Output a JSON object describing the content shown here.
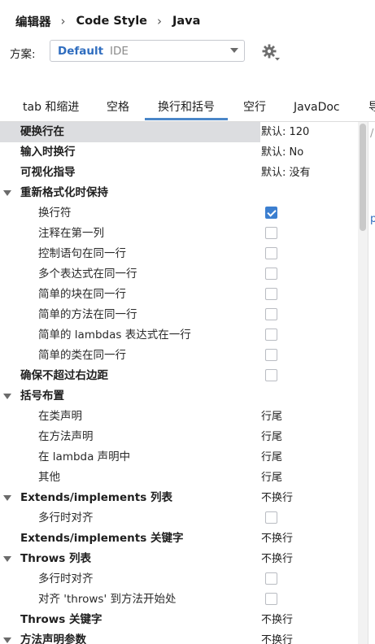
{
  "breadcrumb": [
    "编辑器",
    "Code Style",
    "Java"
  ],
  "scheme": {
    "label": "方案:",
    "name": "Default",
    "scope": "IDE"
  },
  "tabs": [
    {
      "label": "tab 和缩进",
      "active": false
    },
    {
      "label": "空格",
      "active": false
    },
    {
      "label": "换行和括号",
      "active": true
    },
    {
      "label": "空行",
      "active": false
    },
    {
      "label": "JavaDoc",
      "active": false
    },
    {
      "label": "导",
      "active": false
    }
  ],
  "preview_fragments": [
    "/",
    "p"
  ],
  "rows": [
    {
      "label": "硬换行在",
      "level": 0,
      "group": false,
      "selected": true,
      "value": "默认: 120"
    },
    {
      "label": "输入时换行",
      "level": 0,
      "group": false,
      "value": "默认: No"
    },
    {
      "label": "可视化指导",
      "level": 0,
      "group": false,
      "value": "默认: 没有"
    },
    {
      "label": "重新格式化时保持",
      "level": 0,
      "group": true
    },
    {
      "label": "换行符",
      "level": 1,
      "checkbox": true,
      "checked": true
    },
    {
      "label": "注释在第一列",
      "level": 1,
      "checkbox": true,
      "checked": false
    },
    {
      "label": "控制语句在同一行",
      "level": 1,
      "checkbox": true,
      "checked": false
    },
    {
      "label": "多个表达式在同一行",
      "level": 1,
      "checkbox": true,
      "checked": false
    },
    {
      "label": "简单的块在同一行",
      "level": 1,
      "checkbox": true,
      "checked": false
    },
    {
      "label": "简单的方法在同一行",
      "level": 1,
      "checkbox": true,
      "checked": false
    },
    {
      "label": "简单的 lambdas 表达式在一行",
      "level": 1,
      "checkbox": true,
      "checked": false
    },
    {
      "label": "简单的类在同一行",
      "level": 1,
      "checkbox": true,
      "checked": false
    },
    {
      "label": "确保不超过右边距",
      "level": 0,
      "group": false,
      "checkbox": true,
      "checked": false
    },
    {
      "label": "括号布置",
      "level": 0,
      "group": true
    },
    {
      "label": "在类声明",
      "level": 1,
      "value": "行尾"
    },
    {
      "label": "在方法声明",
      "level": 1,
      "value": "行尾"
    },
    {
      "label": "在 lambda 声明中",
      "level": 1,
      "value": "行尾"
    },
    {
      "label": "其他",
      "level": 1,
      "value": "行尾"
    },
    {
      "label": "Extends/implements 列表",
      "level": 0,
      "group": true,
      "value": "不换行"
    },
    {
      "label": "多行时对齐",
      "level": 1,
      "checkbox": true,
      "checked": false
    },
    {
      "label": "Extends/implements 关键字",
      "level": 0,
      "group": false,
      "value": "不换行"
    },
    {
      "label": "Throws 列表",
      "level": 0,
      "group": true,
      "value": "不换行"
    },
    {
      "label": "多行时对齐",
      "level": 1,
      "checkbox": true,
      "checked": false
    },
    {
      "label": "对齐 'throws' 到方法开始处",
      "level": 1,
      "checkbox": true,
      "checked": false
    },
    {
      "label": "Throws 关键字",
      "level": 0,
      "group": false,
      "value": "不换行"
    },
    {
      "label": "方法声明参数",
      "level": 0,
      "group": true,
      "value": "不换行"
    }
  ]
}
